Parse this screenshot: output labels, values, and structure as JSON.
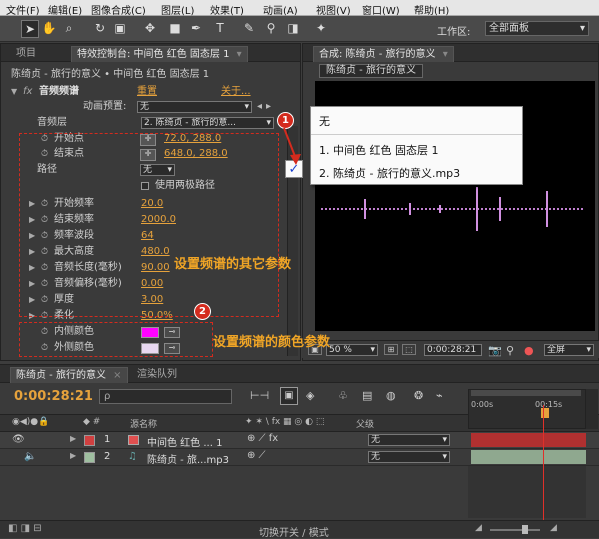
{
  "menu": [
    "文件(F)",
    "编辑(E)",
    "图像合成(C)",
    "图层(L)",
    "效果(T)",
    "动画(A)",
    "视图(V)",
    "窗口(W)",
    "帮助(H)"
  ],
  "workspace": {
    "label": "工作区:",
    "value": "全部面板"
  },
  "left_panel": {
    "tab_project": "项目",
    "tab_effects": "特效控制台: 中间色 红色 固态层 1",
    "header": "陈绮贞 - 旅行的意义 • 中间色 红色 固态层 1",
    "effect": {
      "icon": "fx",
      "name": "音频频谱",
      "reset": "重置",
      "about": "关于..."
    },
    "anim_preset": {
      "label": "动画预置:",
      "value": "无"
    },
    "audio_layer": {
      "label": "音频层",
      "value": "2. 陈绮贞 - 旅行的意..."
    },
    "start_point": {
      "label": "开始点",
      "value": "72.0, 288.0"
    },
    "end_point": {
      "label": "结束点",
      "value": "648.0, 288.0"
    },
    "path": {
      "label": "路径",
      "value": "无"
    },
    "polar": {
      "label": "使用两极路径"
    },
    "start_freq": {
      "label": "开始频率",
      "value": "20.0"
    },
    "end_freq": {
      "label": "结束频率",
      "value": "2000.0"
    },
    "freq_bands": {
      "label": "频率波段",
      "value": "64"
    },
    "max_height": {
      "label": "最大高度",
      "value": "480.0"
    },
    "audio_duration": {
      "label": "音频长度(毫秒)",
      "value": "90.00"
    },
    "audio_offset": {
      "label": "音频偏移(毫秒)",
      "value": "0.00"
    },
    "thickness": {
      "label": "厚度",
      "value": "3.00"
    },
    "softness": {
      "label": "柔化",
      "value": "50.0%"
    },
    "inner_color": {
      "label": "内侧颜色",
      "color": "#ff00ff"
    },
    "outer_color": {
      "label": "外侧颜色",
      "color": "#e8d8f0"
    }
  },
  "annotations": {
    "badge1": "1",
    "badge2": "2",
    "text1": "设置频谱的其它参数",
    "text2": "设置频谱的颜色参数"
  },
  "popup": {
    "items": [
      "无",
      "1. 中间色 红色 固态层 1",
      "2. 陈绮贞 - 旅行的意义.mp3"
    ],
    "checkmark": "✓"
  },
  "comp_panel": {
    "tab": "合成: 陈绮贞 - 旅行的意义",
    "sub_tab": "陈绮贞 - 旅行的意义",
    "zoom": "50 %",
    "timecode": "0:00:28:21",
    "resolution": "全屏"
  },
  "timeline": {
    "tab": "陈绮贞 - 旅行的意义",
    "tab2": "渲染队列",
    "timecode": "0:00:28:21",
    "search_placeholder": "ρ",
    "col_source": "源名称",
    "col_parent": "父级",
    "ruler": [
      "0:00s",
      "00:15s"
    ],
    "layers": [
      {
        "num": "1",
        "name": "中间色 红色 ... 1",
        "color": "#e05050",
        "parent": "无"
      },
      {
        "num": "2",
        "name": "陈绮贞 - 旅...mp3",
        "color": "#9fbfa0",
        "parent": "无"
      }
    ],
    "footer": "切换开关 / 模式"
  }
}
